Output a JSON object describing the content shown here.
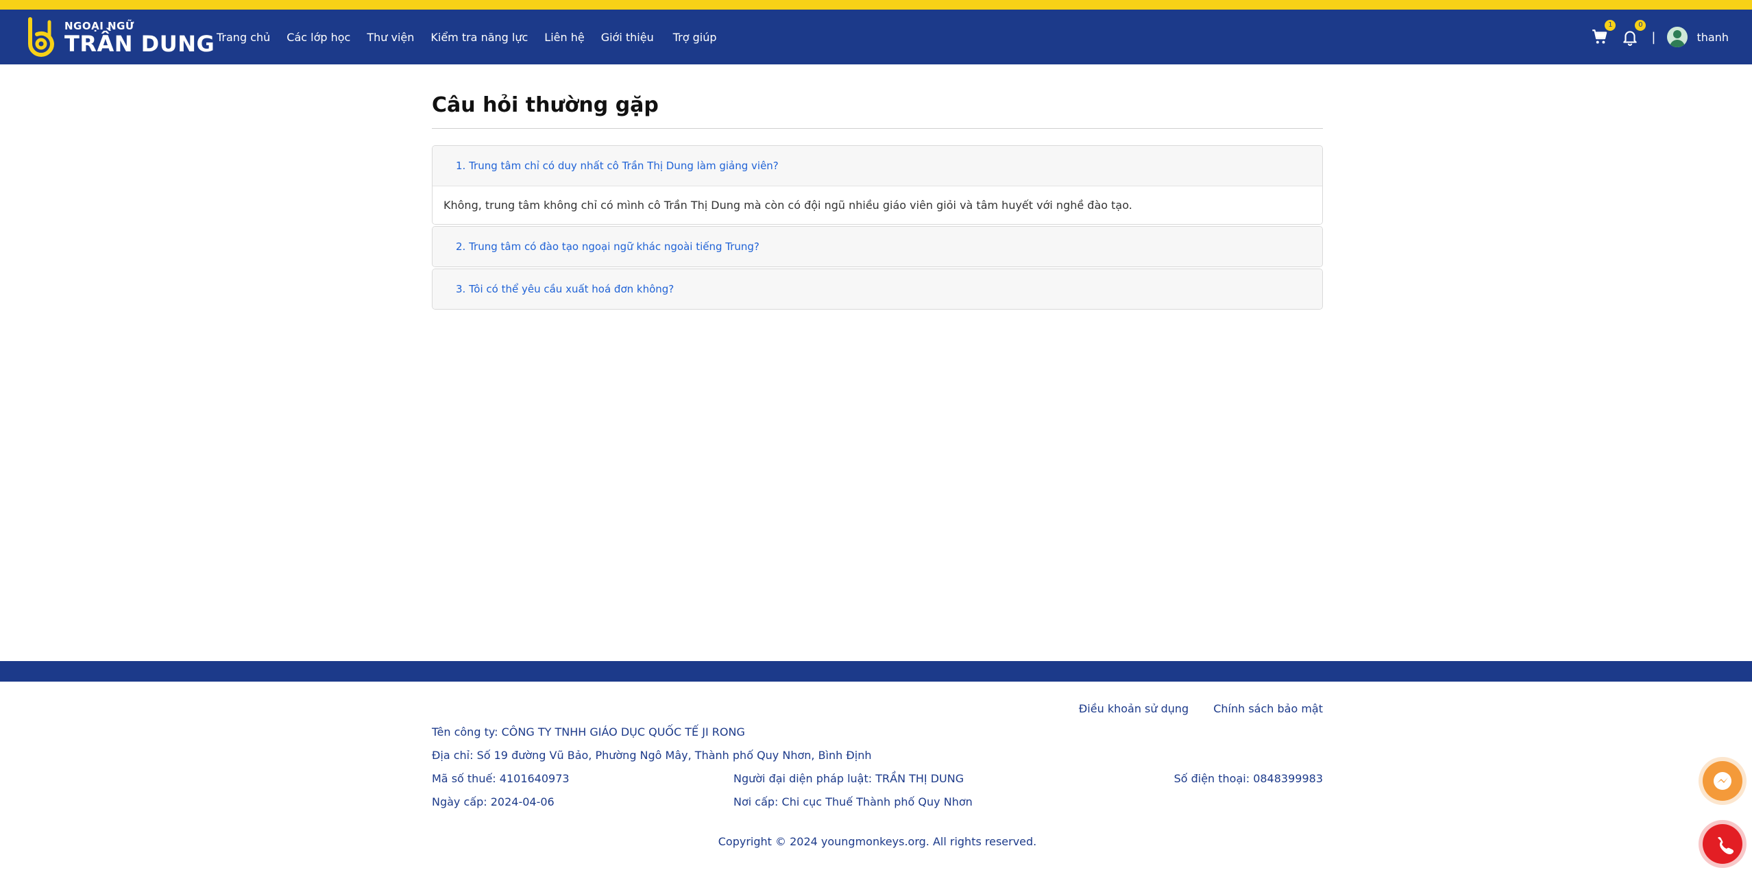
{
  "header": {
    "logo_small": "NGOẠI NGỮ",
    "logo_main": "TRẦN DUNG",
    "nav": [
      {
        "label": "Trang chủ"
      },
      {
        "label": "Các lớp học"
      },
      {
        "label": "Thư viện"
      },
      {
        "label": "Kiểm tra năng lực"
      },
      {
        "label": "Liên hệ"
      },
      {
        "label": "Giới thiệu"
      },
      {
        "label": "Trợ giúp"
      }
    ],
    "cart_count": "1",
    "notification_count": "0",
    "separator": "|",
    "username": "thanh"
  },
  "main": {
    "title": "Câu hỏi thường gặp",
    "faqs": [
      {
        "question": "1. Trung tâm chỉ có duy nhất cô Trần Thị Dung làm giảng viên?",
        "answer": "Không, trung tâm không chỉ có mình cô Trần Thị Dung mà còn có đội ngũ nhiều giáo viên giỏi và tâm huyết với nghề đào tạo."
      },
      {
        "question": "2. Trung tâm có đào tạo ngoại ngữ khác ngoài tiếng Trung?"
      },
      {
        "question": "3. Tôi có thể yêu cầu xuất hoá đơn không?"
      }
    ]
  },
  "footer": {
    "terms": "Điều khoản sử dụng",
    "privacy": "Chính sách bảo mật",
    "company": "Tên công ty: CÔNG TY TNHH GIÁO DỤC QUỐC TẾ JI RONG",
    "address": "Địa chỉ: Số 19 đường Vũ Bảo, Phường Ngô Mây, Thành phố Quy Nhơn, Bình Định",
    "tax_code": "Mã số thuế: 4101640973",
    "legal_rep": "Người đại diện pháp luật: TRẦN THỊ DUNG",
    "phone": "Số điện thoại: 0848399983",
    "issue_date": "Ngày cấp: 2024-04-06",
    "issue_place": "Nơi cấp: Chi cục Thuế Thành phố Quy Nhơn",
    "copyright": "Copyright © 2024 youngmonkeys.org. All rights reserved."
  },
  "colors": {
    "brand_blue": "#1c3a8a",
    "accent_yellow": "#f7d117",
    "link_blue": "#1f62d6",
    "messenger_orange": "#f49a3a",
    "phone_red": "#e31e24"
  },
  "icons": [
    "cart-icon",
    "bell-icon",
    "messenger-icon",
    "phone-icon"
  ]
}
